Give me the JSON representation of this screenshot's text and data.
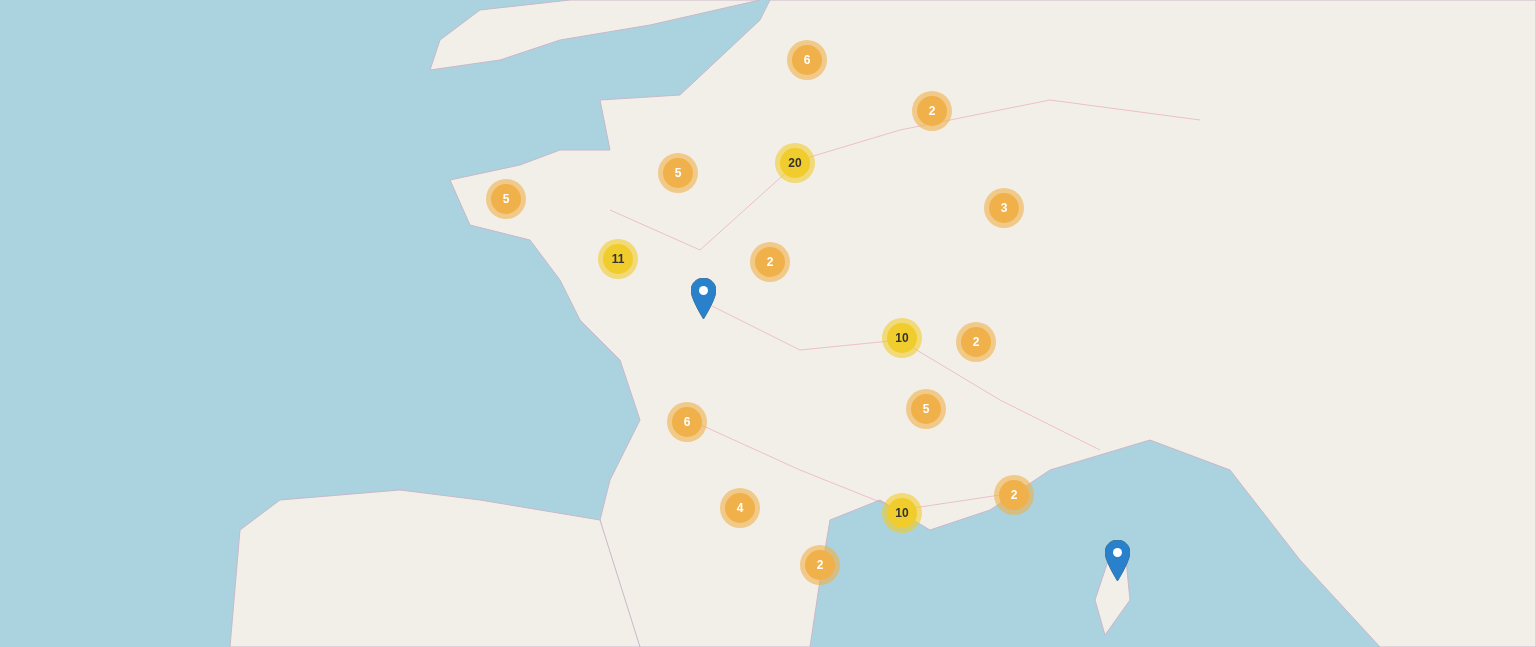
{
  "clusters": [
    {
      "count": "6",
      "kind": "small",
      "color": "#f0b04a"
    },
    {
      "count": "2",
      "kind": "small",
      "color": "#f0b04a"
    },
    {
      "count": "20",
      "kind": "medium",
      "color": "#f0cc2c"
    },
    {
      "count": "5",
      "kind": "small",
      "color": "#f0b04a"
    },
    {
      "count": "5",
      "kind": "small",
      "color": "#f0b04a"
    },
    {
      "count": "3",
      "kind": "small",
      "color": "#f0b04a"
    },
    {
      "count": "11",
      "kind": "medium",
      "color": "#f0cc2c"
    },
    {
      "count": "2",
      "kind": "small",
      "color": "#f0b04a"
    },
    {
      "count": "10",
      "kind": "medium",
      "color": "#f0cc2c"
    },
    {
      "count": "2",
      "kind": "small",
      "color": "#f0b04a"
    },
    {
      "count": "5",
      "kind": "small",
      "color": "#f0b04a"
    },
    {
      "count": "6",
      "kind": "small",
      "color": "#f0b04a"
    },
    {
      "count": "2",
      "kind": "small",
      "color": "#f0b04a"
    },
    {
      "count": "4",
      "kind": "small",
      "color": "#f0b04a"
    },
    {
      "count": "10",
      "kind": "medium",
      "color": "#f0cc2c"
    },
    {
      "count": "2",
      "kind": "small",
      "color": "#f0b04a"
    }
  ],
  "pins": [
    {
      "kind": "location"
    },
    {
      "kind": "location"
    }
  ]
}
